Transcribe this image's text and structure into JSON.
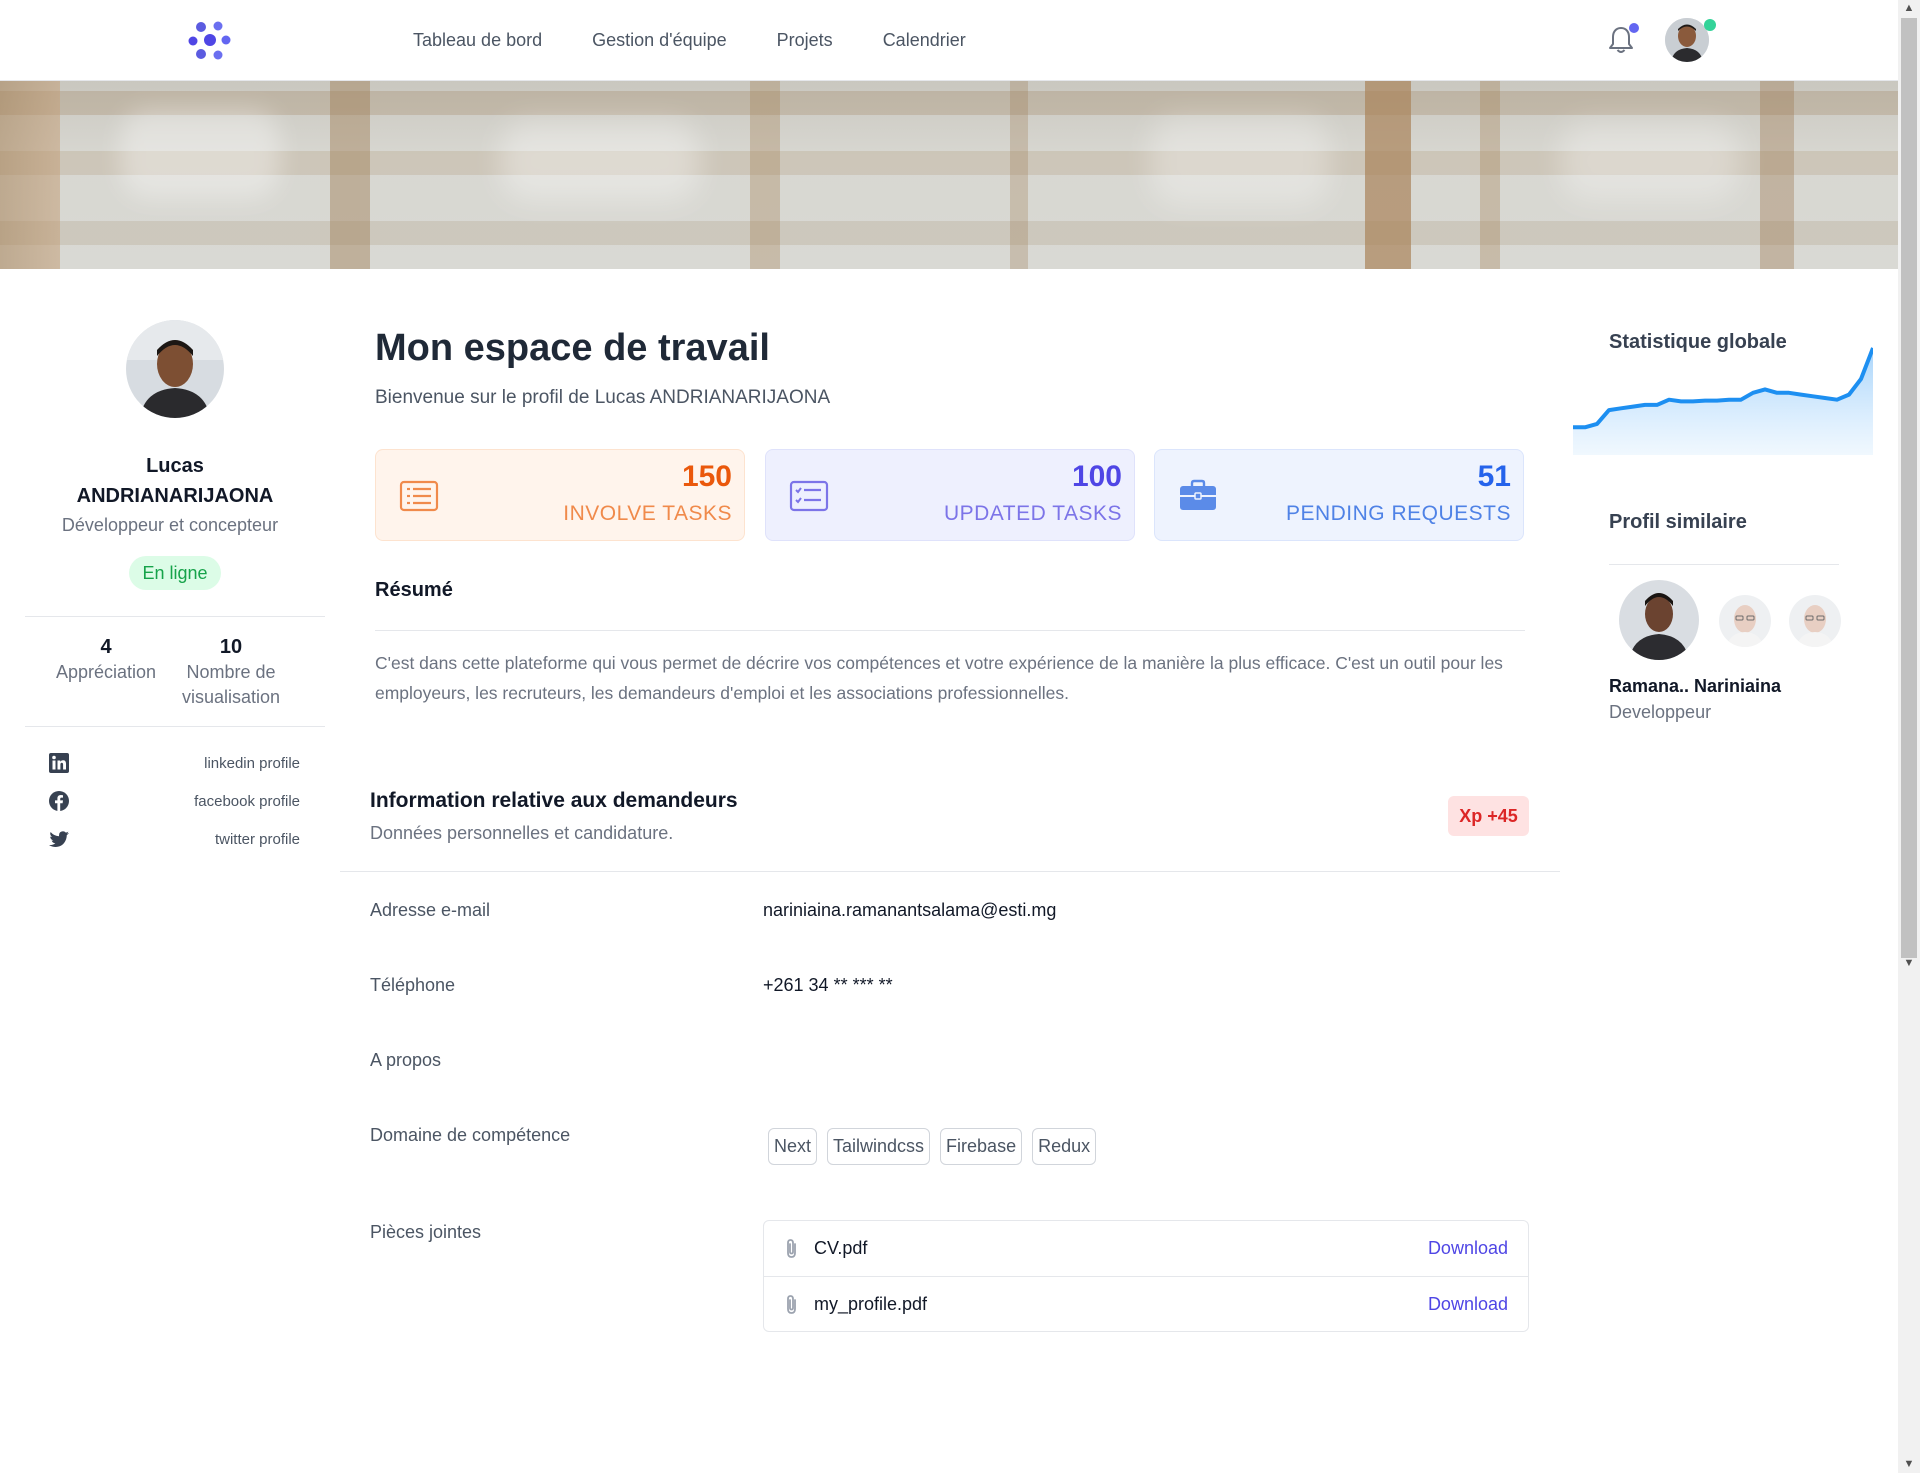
{
  "nav": {
    "links": [
      "Tableau de bord",
      "Gestion d'équipe",
      "Projets",
      "Calendrier"
    ]
  },
  "profile": {
    "first_name": "Lucas",
    "last_name": "ANDRIANARIJAONA",
    "role": "Développeur et concepteur",
    "status": "En ligne",
    "stats": [
      {
        "value": "4",
        "label": "Appréciation"
      },
      {
        "value": "10",
        "label": "Nombre de visualisation"
      }
    ],
    "social": [
      {
        "icon": "linkedin-icon",
        "label": "linkedin profile"
      },
      {
        "icon": "facebook-icon",
        "label": "facebook profile"
      },
      {
        "icon": "twitter-icon",
        "label": "twitter profile"
      }
    ]
  },
  "main": {
    "title": "Mon espace de travail",
    "subtitle": "Bienvenue sur le profil de Lucas ANDRIANARIJAONA",
    "cards": [
      {
        "icon": "list-icon",
        "value": "150",
        "label": "INVOLVE TASKS",
        "color": "#ea580c"
      },
      {
        "icon": "checklist-icon",
        "value": "100",
        "label": "UPDATED TASKS",
        "color": "#4f46e5"
      },
      {
        "icon": "briefcase-icon",
        "value": "51",
        "label": "PENDING REQUESTS",
        "color": "#2563eb"
      }
    ],
    "resume_title": "Résumé",
    "resume_text": "C'est dans cette plateforme qui vous permet de décrire vos compétences et votre expérience de la manière la plus efficace. C'est un outil pour les employeurs, les recruteurs, les demandeurs d'emploi et les associations professionnelles.",
    "info_title": "Information relative aux demandeurs",
    "info_subtitle": "Données personnelles et candidature.",
    "xp_badge": "Xp +45",
    "fields": {
      "email_label": "Adresse e-mail",
      "email_value": "nariniaina.ramanantsalama@esti.mg",
      "phone_label": "Téléphone",
      "phone_value": "+261 34 ** *** **",
      "about_label": "A propos",
      "skills_label": "Domaine de compétence",
      "skills": [
        "Next",
        "Tailwindcss",
        "Firebase",
        "Redux"
      ],
      "attachments_label": "Pièces jointes",
      "attachments": [
        {
          "name": "CV.pdf",
          "action": "Download"
        },
        {
          "name": "my_profile.pdf",
          "action": "Download"
        }
      ]
    }
  },
  "sidebar_right": {
    "stat_title": "Statistique globale",
    "sparkline_values": [
      12,
      12,
      14,
      22,
      23,
      24,
      25,
      25,
      28,
      27,
      27,
      27.5,
      27.5,
      28,
      28,
      32,
      34,
      32,
      32,
      31,
      30,
      29,
      28,
      31,
      40,
      58
    ],
    "accent": "#1d8ff1",
    "similar_title": "Profil similaire",
    "similar_name": "Ramana.. Nariniaina",
    "similar_role": "Developpeur"
  }
}
